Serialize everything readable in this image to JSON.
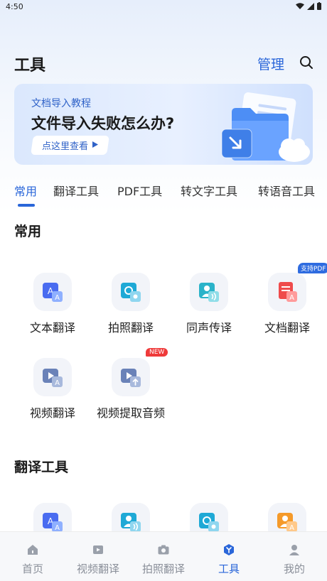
{
  "status_bar": {
    "time": "4:50"
  },
  "header": {
    "title": "工具",
    "manage_label": "管理"
  },
  "banner": {
    "subtitle": "文档导入教程",
    "title": "文件导入失败怎么办?",
    "button_label": "点这里查看"
  },
  "tabs": [
    {
      "label": "常用",
      "active": true
    },
    {
      "label": "翻译工具",
      "active": false
    },
    {
      "label": "PDF工具",
      "active": false
    },
    {
      "label": "转文字工具",
      "active": false
    },
    {
      "label": "转语音工具",
      "active": false
    }
  ],
  "sections": {
    "common": {
      "title": "常用",
      "tools": [
        {
          "label": "文本翻译",
          "icon": "text-translate-icon"
        },
        {
          "label": "拍照翻译",
          "icon": "photo-translate-icon"
        },
        {
          "label": "同声传译",
          "icon": "simultaneous-interpretation-icon"
        },
        {
          "label": "文档翻译",
          "icon": "document-translate-icon",
          "badge": "支持PDF"
        },
        {
          "label": "视频翻译",
          "icon": "video-translate-icon"
        },
        {
          "label": "视频提取音频",
          "icon": "video-extract-audio-icon",
          "badge": "NEW"
        }
      ]
    },
    "translate": {
      "title": "翻译工具",
      "tools": [
        {
          "icon": "text-translate-icon"
        },
        {
          "icon": "voice-translate-icon"
        },
        {
          "icon": "photo-translate-icon"
        },
        {
          "icon": "person-translate-icon"
        }
      ]
    }
  },
  "bottom_nav": [
    {
      "label": "首页",
      "icon": "home-icon",
      "active": false
    },
    {
      "label": "视频翻译",
      "icon": "video-icon",
      "active": false
    },
    {
      "label": "拍照翻译",
      "icon": "camera-icon",
      "active": false
    },
    {
      "label": "工具",
      "icon": "tools-icon",
      "active": true
    },
    {
      "label": "我的",
      "icon": "profile-icon",
      "active": false
    }
  ],
  "colors": {
    "accent": "#2a66d9",
    "badge_pdf": "#2f6ce0",
    "badge_new": "#ef3a3a",
    "nav_inactive": "#8a8f99"
  }
}
